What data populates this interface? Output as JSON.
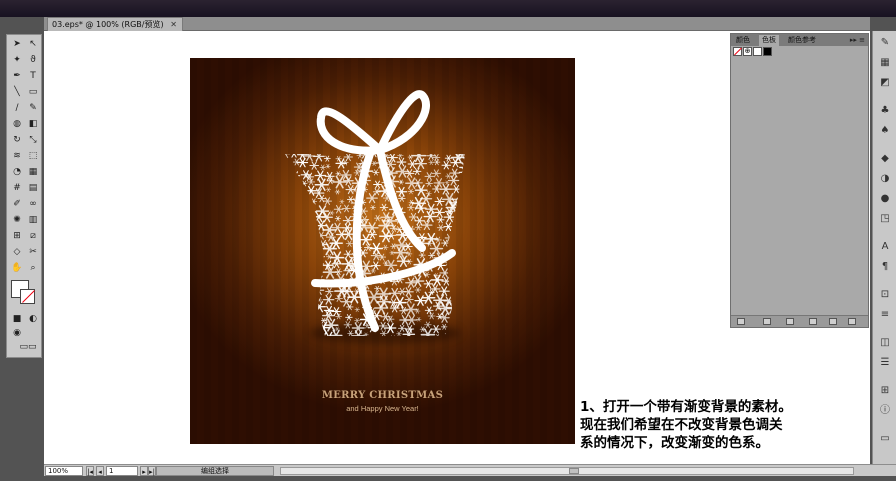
{
  "document": {
    "tab_title": "03.eps* @ 100% (RGB/预览)",
    "close_glyph": "✕"
  },
  "color_panel": {
    "tabs": [
      "颜色",
      "色板",
      "颜色参考"
    ],
    "menu_glyph": "▸▸ ≡",
    "footer_icons": [
      "swatch-libraries",
      "show-kinds",
      "swatch-options",
      "new-color-group",
      "new-swatch",
      "delete-swatch"
    ]
  },
  "artwork": {
    "title": "MERRY CHRISTMAS",
    "subtitle": "and Happy New Year!",
    "colors": {
      "center": "#c2701a",
      "edge": "#2e0e02",
      "title": "#c7a27a",
      "subtitle": "#d8b68e"
    }
  },
  "status": {
    "zoom": "100%",
    "page": "1",
    "status_text": "编组选择"
  },
  "caption": {
    "lines": [
      "1、打开一个带有渐变背景的素材。",
      "现在我们希望在不改变背景色调关",
      "系的情况下，改变渐变的色系。"
    ]
  }
}
